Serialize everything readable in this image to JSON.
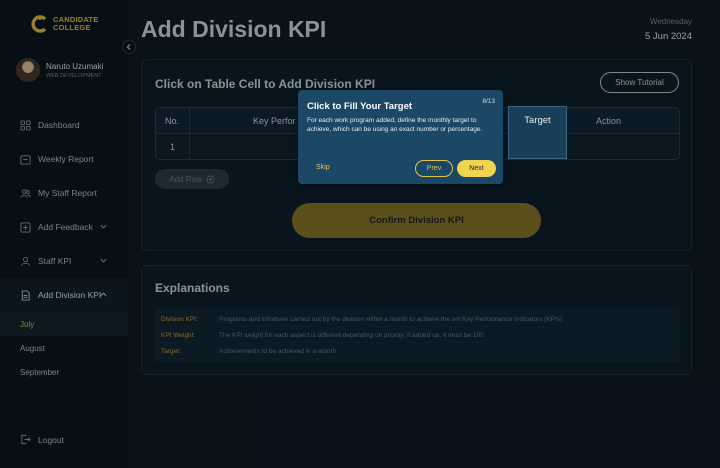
{
  "brand": {
    "line1": "CANDIDATE",
    "line2": "COLLEGE",
    "color": "#e8c04a"
  },
  "profile": {
    "name": "Naruto Uzumaki",
    "role": "WEB DEVELOPMENT"
  },
  "nav": {
    "dashboard": "Dashboard",
    "weekly_report": "Weekly Report",
    "my_staff_report": "My Staff Report",
    "add_feedback": "Add Feedback",
    "staff_kpi": "Staff KPI",
    "add_division_kpi": "Add Division KPI",
    "sub": [
      "July",
      "August",
      "September"
    ],
    "logout": "Logout"
  },
  "header": {
    "title": "Add Division KPI",
    "day": "Wednesday",
    "date": "5 Jun 2024"
  },
  "kpi_card": {
    "title": "Click on Table Cell to Add Division KPI",
    "tutorial_label": "Show Tutorial",
    "columns": {
      "no": "No.",
      "program": "Key Perfor",
      "target": "Target",
      "action": "Action"
    },
    "rows": [
      {
        "no": "1"
      }
    ],
    "add_row_label": "Add Row",
    "confirm_label": "Confirm Division KPI"
  },
  "explanations": {
    "title": "Explanations",
    "items": [
      {
        "term": "Division KPI:",
        "definition": "Programs and initiatives carried out by the division within a month to achieve the set Key Performance Indicators (KPIs)."
      },
      {
        "term": "KPI Weight:",
        "definition": "The KPI weight for each aspect is different depending on priority; if added up, it must be 100."
      },
      {
        "term": "Target:",
        "definition": "Achievements to be achieved in a month"
      }
    ]
  },
  "tutorial": {
    "title": "Click to Fill Your Target",
    "step": "8/13",
    "body": "For each work program added, define the monthly target to achieve, which can be using an exact number or percentage.",
    "skip": "Skip",
    "prev": "Prev",
    "next": "Next"
  }
}
